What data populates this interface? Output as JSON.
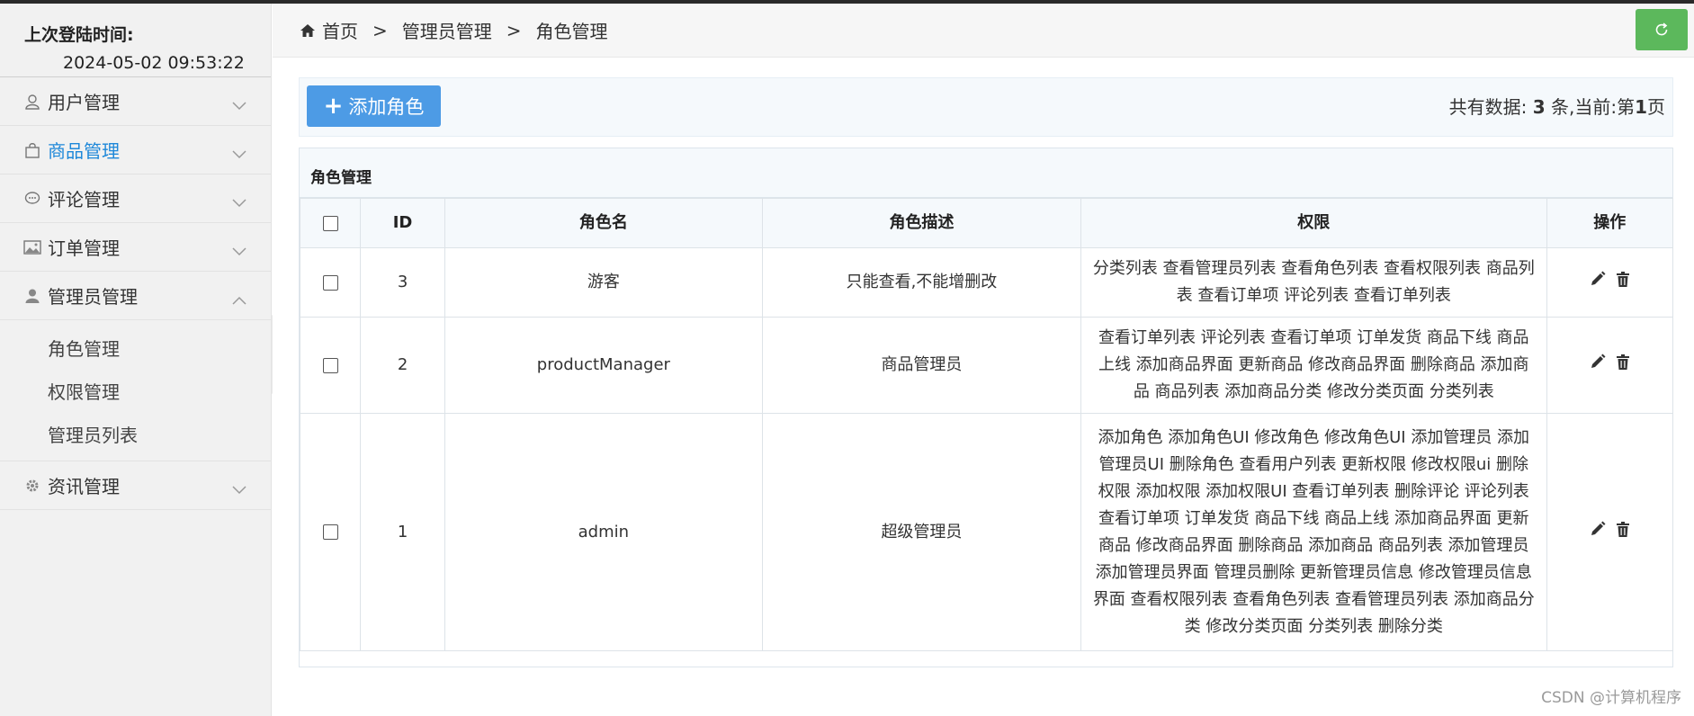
{
  "sidebar": {
    "login_label": "上次登陆时间:",
    "login_time": "2024-05-02 09:53:22",
    "menu": [
      {
        "label": "用户管理",
        "icon": "user-icon"
      },
      {
        "label": "商品管理",
        "icon": "bag-icon"
      },
      {
        "label": "评论管理",
        "icon": "comment-icon"
      },
      {
        "label": "订单管理",
        "icon": "image-icon"
      },
      {
        "label": "管理员管理",
        "icon": "admin-icon"
      },
      {
        "label": "资讯管理",
        "icon": "gear-icon"
      }
    ],
    "submenu": [
      "角色管理",
      "权限管理",
      "管理员列表"
    ]
  },
  "breadcrumb": [
    "首页",
    "管理员管理",
    "角色管理"
  ],
  "toolbar": {
    "add_label": "添加角色",
    "info_prefix": "共有数据:",
    "total": "3",
    "info_mid": "条,当前:第",
    "page": "1",
    "info_suffix": "页"
  },
  "panel_title": "角色管理",
  "table": {
    "headers": [
      "ID",
      "角色名",
      "角色描述",
      "权限",
      "操作"
    ],
    "rows": [
      {
        "id": "3",
        "name": "游客",
        "desc": "只能查看,不能增删改",
        "perms": "分类列表 查看管理员列表 查看角色列表 查看权限列表 商品列表 查看订单项 评论列表 查看订单列表"
      },
      {
        "id": "2",
        "name": "productManager",
        "desc": "商品管理员",
        "perms": "查看订单列表 评论列表 查看订单项 订单发货 商品下线 商品上线 添加商品界面 更新商品 修改商品界面 删除商品 添加商品 商品列表 添加商品分类 修改分类页面 分类列表"
      },
      {
        "id": "1",
        "name": "admin",
        "desc": "超级管理员",
        "perms": "添加角色 添加角色UI 修改角色 修改角色UI 添加管理员 添加管理员UI 删除角色 查看用户列表 更新权限 修改权限ui 删除权限 添加权限 添加权限UI 查看订单列表 删除评论 评论列表 查看订单项 订单发货 商品下线 商品上线 添加商品界面 更新商品 修改商品界面 删除商品 添加商品 商品列表 添加管理员 添加管理员界面 管理员删除 更新管理员信息 修改管理员信息界面 查看权限列表 查看角色列表 查看管理员列表 添加商品分类 修改分类页面 分类列表 删除分类"
      }
    ]
  },
  "watermark": "CSDN @计算机程序",
  "colors": {
    "accent": "#1e88d9",
    "add_button": "#4d9be5",
    "refresh_button": "#5cb85c"
  }
}
